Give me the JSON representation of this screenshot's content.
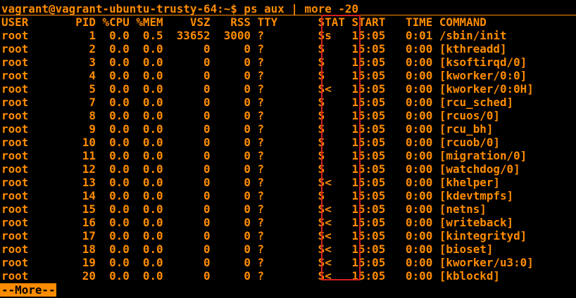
{
  "terminal": {
    "prompt": "vagrant@vagrant-ubuntu-trusty-64:~$ ps aux | more -20",
    "header": "USER       PID %CPU %MEM    VSZ   RSS TTY      STAT START   TIME COMMAND",
    "rows": [
      "root         1  0.0  0.5  33652  3000 ?        Ss   15:05   0:01 /sbin/init",
      "root         2  0.0  0.0      0     0 ?        S    15:05   0:00 [kthreadd]",
      "root         3  0.0  0.0      0     0 ?        S    15:05   0:00 [ksoftirqd/0]",
      "root         4  0.0  0.0      0     0 ?        S    15:05   0:00 [kworker/0:0]",
      "root         5  0.0  0.0      0     0 ?        S<   15:05   0:00 [kworker/0:0H]",
      "root         7  0.0  0.0      0     0 ?        S    15:05   0:00 [rcu_sched]",
      "root         8  0.0  0.0      0     0 ?        S    15:05   0:00 [rcuos/0]",
      "root         9  0.0  0.0      0     0 ?        S    15:05   0:00 [rcu_bh]",
      "root        10  0.0  0.0      0     0 ?        S    15:05   0:00 [rcuob/0]",
      "root        11  0.0  0.0      0     0 ?        S    15:05   0:00 [migration/0]",
      "root        12  0.0  0.0      0     0 ?        S    15:05   0:00 [watchdog/0]",
      "root        13  0.0  0.0      0     0 ?        S<   15:05   0:00 [khelper]",
      "root        14  0.0  0.0      0     0 ?        S    15:05   0:00 [kdevtmpfs]",
      "root        15  0.0  0.0      0     0 ?        S<   15:05   0:00 [netns]",
      "root        16  0.0  0.0      0     0 ?        S<   15:05   0:00 [writeback]",
      "root        17  0.0  0.0      0     0 ?        S<   15:05   0:00 [kintegrityd]",
      "root        18  0.0  0.0      0     0 ?        S<   15:05   0:00 [bioset]",
      "root        19  0.0  0.0      0     0 ?        S<   15:05   0:00 [kworker/u3:0]",
      "root        20  0.0  0.0      0     0 ?        S<   15:05   0:00 [kblockd]"
    ],
    "pager_prompt": "--More--"
  },
  "colors": {
    "background": "#000000",
    "foreground": "#ff8c00",
    "highlight_box": "#d2201d"
  }
}
